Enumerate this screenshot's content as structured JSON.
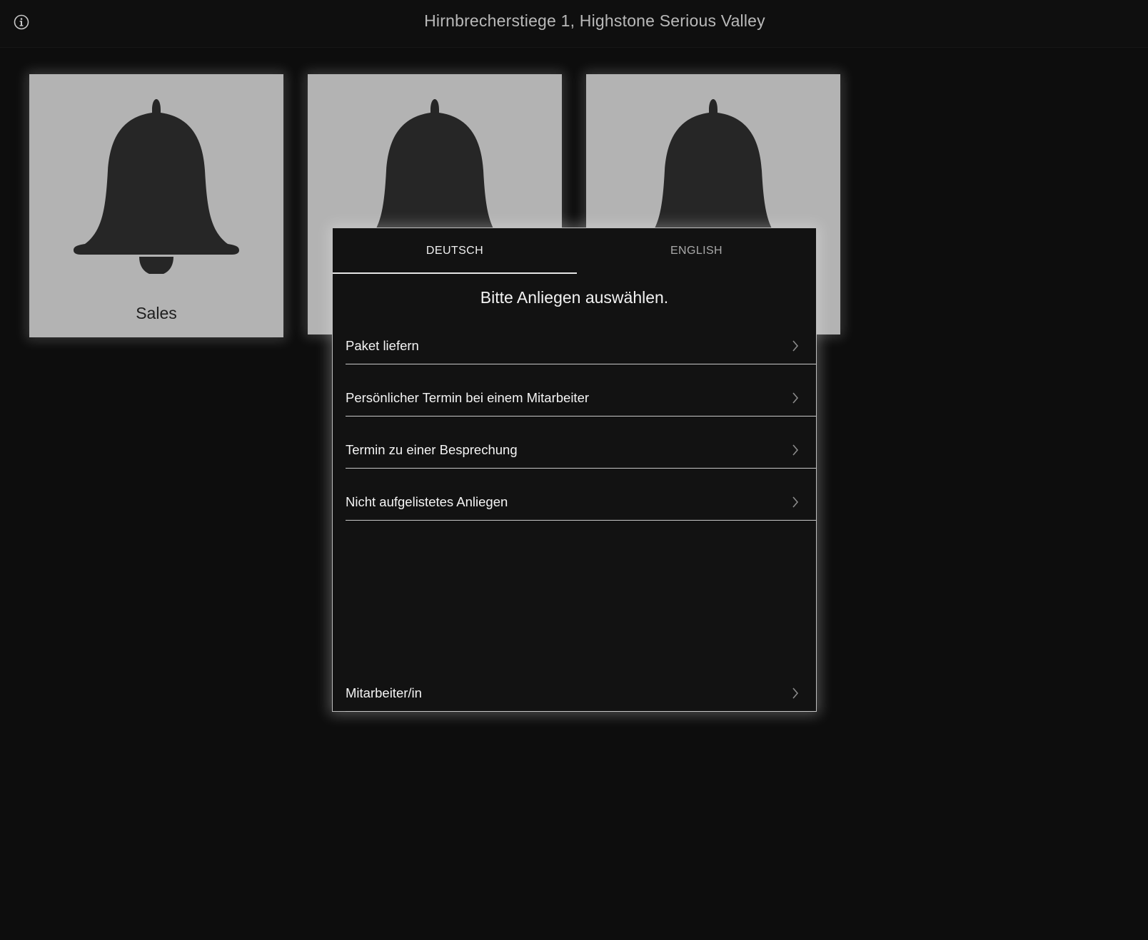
{
  "header": {
    "address": "Hirnbrecherstiege 1, Highstone Serious Valley",
    "info_icon": "info-circle-icon"
  },
  "tiles": [
    {
      "label": "Sales",
      "icon": "bell-icon"
    },
    {
      "label": "",
      "icon": "bell-icon"
    },
    {
      "label": "",
      "icon": "bell-icon"
    }
  ],
  "dialog": {
    "tabs": [
      {
        "label": "DEUTSCH",
        "active": true
      },
      {
        "label": "ENGLISH",
        "active": false
      }
    ],
    "prompt": "Bitte Anliegen auswählen.",
    "options": [
      {
        "label": "Paket liefern",
        "icon": "chevron-right-icon"
      },
      {
        "label": "Persönlicher Termin bei einem Mitarbeiter",
        "icon": "chevron-right-icon"
      },
      {
        "label": "Termin zu einer Besprechung",
        "icon": "chevron-right-icon"
      },
      {
        "label": "Nicht aufgelistetes Anliegen",
        "icon": "chevron-right-icon"
      }
    ],
    "staff_option": {
      "label": "Mitarbeiter/in",
      "icon": "chevron-right-icon"
    }
  },
  "colors": {
    "background": "#0d0d0d",
    "tile": "#b3b3b3",
    "bell": "#262626",
    "dialog": "#121212",
    "text": "#f4f4f4"
  }
}
